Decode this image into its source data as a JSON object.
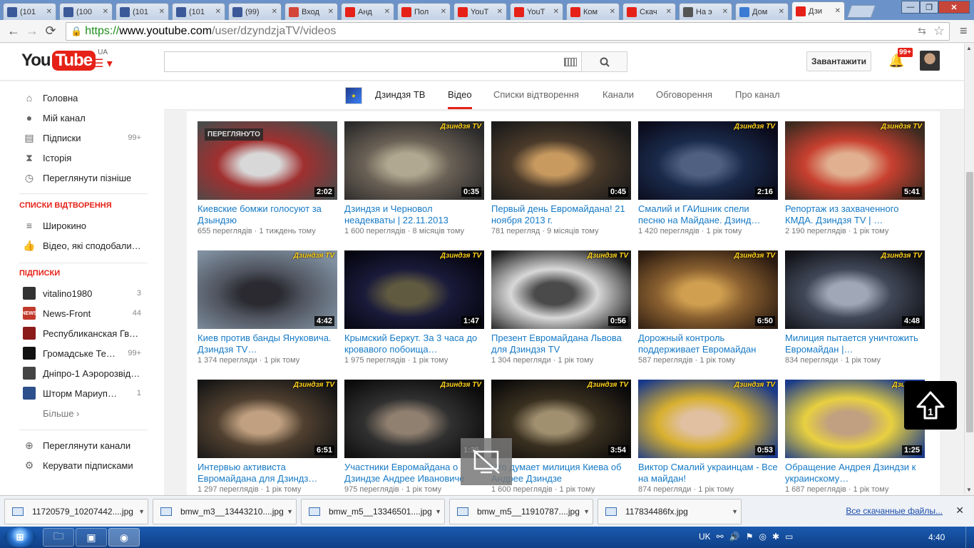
{
  "browser": {
    "tabs": [
      {
        "title": "(101",
        "icon": "facebook-icon",
        "color": "#3b5998"
      },
      {
        "title": "(100",
        "icon": "facebook-icon",
        "color": "#3b5998"
      },
      {
        "title": "(101",
        "icon": "facebook-icon",
        "color": "#3b5998"
      },
      {
        "title": "(101",
        "icon": "facebook-icon",
        "color": "#3b5998"
      },
      {
        "title": "(99)",
        "icon": "facebook-icon",
        "color": "#3b5998"
      },
      {
        "title": "Вход",
        "icon": "gmail-icon",
        "color": "#d44638"
      },
      {
        "title": "Анд",
        "icon": "youtube-icon",
        "color": "#e62117"
      },
      {
        "title": "Пол",
        "icon": "youtube-icon",
        "color": "#e62117"
      },
      {
        "title": "YouT",
        "icon": "youtube-icon",
        "color": "#e62117"
      },
      {
        "title": "YouT",
        "icon": "youtube-icon",
        "color": "#e62117"
      },
      {
        "title": "Ком",
        "icon": "youtube-icon",
        "color": "#e62117"
      },
      {
        "title": "Скач",
        "icon": "youtube-icon",
        "color": "#e62117"
      },
      {
        "title": "На э",
        "icon": "site-icon",
        "color": "#555555"
      },
      {
        "title": "Дом",
        "icon": "loading-icon",
        "color": "#3b7bd4"
      },
      {
        "title": "Дзи",
        "icon": "youtube-icon",
        "color": "#e62117",
        "active": true
      }
    ],
    "url": {
      "scheme": "https://",
      "host": "www.youtube.com",
      "path": "/user/dzyndzjaTV/videos"
    }
  },
  "youtube": {
    "logo": {
      "you": "You",
      "tube": "Tube",
      "region": "UA"
    },
    "search": {
      "placeholder": "",
      "value": ""
    },
    "upload_label": "Завантажити",
    "notifications": "99+"
  },
  "sidebar": {
    "main": [
      {
        "label": "Головна",
        "icon": "home-icon"
      },
      {
        "label": "Мій канал",
        "icon": "account-icon"
      },
      {
        "label": "Підписки",
        "icon": "subscriptions-icon",
        "count": "99+"
      },
      {
        "label": "Історія",
        "icon": "history-icon"
      },
      {
        "label": "Переглянути пізніше",
        "icon": "watch-later-icon"
      }
    ],
    "playlists_heading": "СПИСКИ ВІДТВОРЕННЯ",
    "playlists": [
      {
        "label": "Широкино",
        "icon": "playlist-icon"
      },
      {
        "label": "Відео, які сподобалися",
        "icon": "thumb-up-icon"
      }
    ],
    "subs_heading": "ПІДПИСКИ",
    "subscriptions": [
      {
        "label": "vitalino1980",
        "count": "3",
        "color": "#333333",
        "tag": ""
      },
      {
        "label": "News-Front",
        "count": "44",
        "color": "#c0392b",
        "tag": "NEWS"
      },
      {
        "label": "Республиканская Гв…",
        "count": "",
        "color": "#8b1a1a",
        "tag": ""
      },
      {
        "label": "Громадське Те…",
        "count": "99+",
        "color": "#111111",
        "tag": ""
      },
      {
        "label": "Дніпро-1 Аэророзвід…",
        "count": "",
        "color": "#444444",
        "tag": ""
      },
      {
        "label": "Шторм Мариуп…",
        "count": "1",
        "color": "#2d4f8c",
        "tag": ""
      }
    ],
    "more_label": "Більше ›",
    "bottom": [
      {
        "label": "Переглянути канали",
        "icon": "add-circle-icon"
      },
      {
        "label": "Керувати підписками",
        "icon": "gear-icon"
      }
    ]
  },
  "channel": {
    "name": "Дзиндзя ТВ",
    "tabs": [
      "Відео",
      "Списки відтворення",
      "Канали",
      "Обговорення",
      "Про канал"
    ],
    "active_tab": "Відео"
  },
  "videos": [
    {
      "title": "Киевские бомжи голосуют за Дзындзю",
      "views": "655 переглядів",
      "age": "1 тиждень тому",
      "duration": "2:02",
      "watched": "ПЕРЕГЛЯНУТО",
      "watermark": "",
      "palette": [
        "#4a4a4a",
        "#a03030",
        "#d8d8d8"
      ]
    },
    {
      "title": "Дзиндзя и Черновол неадекваты | 22.11.2013",
      "views": "1 600 переглядів",
      "age": "8 місяців тому",
      "duration": "0:35",
      "watched": "",
      "watermark": "Дзиндзя TV",
      "palette": [
        "#2a2a2a",
        "#6a6055",
        "#b0a890"
      ]
    },
    {
      "title": "Первый день Евромайдана! 21 ноября 2013 г.",
      "views": "781 перегляд",
      "age": "9 місяців тому",
      "duration": "0:45",
      "watched": "",
      "watermark": "",
      "palette": [
        "#1a1a1a",
        "#4a3a2a",
        "#c89a60"
      ]
    },
    {
      "title": "Смалий и ГАИшник спели песню на Майдане. Дзинд…",
      "views": "1 420 переглядів",
      "age": "1 рік тому",
      "duration": "2:16",
      "watched": "",
      "watermark": "Дзиндзя TV",
      "palette": [
        "#0a0a1a",
        "#1a2a4a",
        "#506080"
      ]
    },
    {
      "title": "Репортаж из захваченного КМДА. Дзиндзя TV | …",
      "views": "2 190 переглядів",
      "age": "1 рік тому",
      "duration": "5:41",
      "watched": "",
      "watermark": "Дзиндзя TV",
      "palette": [
        "#3a2a20",
        "#c84030",
        "#e0b090"
      ]
    },
    {
      "title": "Киев против банды Януковича. Дзиндзя TV…",
      "views": "1 374 перегляди",
      "age": "1 рік тому",
      "duration": "4:42",
      "watched": "",
      "watermark": "Дзиндзя TV",
      "palette": [
        "#8090a0",
        "#505560",
        "#2a2a30"
      ]
    },
    {
      "title": "Крымский Беркут. За 3 часа до кровавого побоища…",
      "views": "1 975 переглядів",
      "age": "1 рік тому",
      "duration": "1:47",
      "watched": "",
      "watermark": "Дзиндзя TV",
      "palette": [
        "#05050f",
        "#1a1a3a",
        "#605a40"
      ]
    },
    {
      "title": "Презент Евромайдана Львова для Дзиндзя TV",
      "views": "1 304 перегляди",
      "age": "1 рік тому",
      "duration": "0:56",
      "watched": "",
      "watermark": "Дзиндзя TV",
      "palette": [
        "#1a1a1a",
        "#d8d8d8",
        "#4a4a4a"
      ]
    },
    {
      "title": "Дорожный контроль поддерживает Евромайдан",
      "views": "587 переглядів",
      "age": "1 рік тому",
      "duration": "6:50",
      "watched": "",
      "watermark": "Дзиндзя TV",
      "palette": [
        "#2a1a10",
        "#8a6030",
        "#d0a050"
      ]
    },
    {
      "title": "Милиция пытается уничтожить Евромайдан |…",
      "views": "834 перегляди",
      "age": "1 рік тому",
      "duration": "4:48",
      "watched": "",
      "watermark": "Дзиндзя TV",
      "palette": [
        "#101015",
        "#404858",
        "#a0a8b8"
      ]
    },
    {
      "title": "Интервью активиста Евромайдана для Дзиндз…",
      "views": "1 297 переглядів",
      "age": "1 рік тому",
      "duration": "6:51",
      "watched": "",
      "watermark": "Дзиндзя TV",
      "palette": [
        "#151515",
        "#504030",
        "#c0a080"
      ]
    },
    {
      "title": "Участники Евромайдана о Дзиндзе Андрее Ивановиче",
      "views": "975 переглядів",
      "age": "1 рік тому",
      "duration": "1:35",
      "watched": "",
      "watermark": "Дзиндзя TV",
      "palette": [
        "#0a0a0a",
        "#303030",
        "#908070"
      ]
    },
    {
      "title": "Что думает милиция Киева об Андрее Дзиндзе",
      "views": "1 600 переглядів",
      "age": "1 рік тому",
      "duration": "3:54",
      "watched": "",
      "watermark": "Дзиндзя TV",
      "palette": [
        "#0a0a0a",
        "#3a3020",
        "#a09070"
      ]
    },
    {
      "title": "Виктор Смалий украинцам - Все на майдан!",
      "views": "874 перегляди",
      "age": "1 рік тому",
      "duration": "0:53",
      "watched": "",
      "watermark": "Дзиндзя TV",
      "palette": [
        "#1a3a8a",
        "#d8b030",
        "#e0c0a0"
      ]
    },
    {
      "title": "Обращение Андрея Дзиндзи к украинскому…",
      "views": "1 687 переглядів",
      "age": "1 рік тому",
      "duration": "1:25",
      "watched": "",
      "watermark": "Дзиндзя",
      "palette": [
        "#1a3a8a",
        "#e8d040",
        "#c0a080"
      ]
    }
  ],
  "downloads": {
    "items": [
      "11720579_10207442....jpg",
      "bmw_m3__13443210....jpg",
      "bmw_m5__13346501....jpg",
      "bmw_m5__11910787....jpg",
      "117834486fx.jpg"
    ],
    "show_all": "Все скачанные файлы..."
  },
  "taskbar": {
    "start_label": "⊞",
    "language": "UK",
    "clock": "4:40"
  }
}
